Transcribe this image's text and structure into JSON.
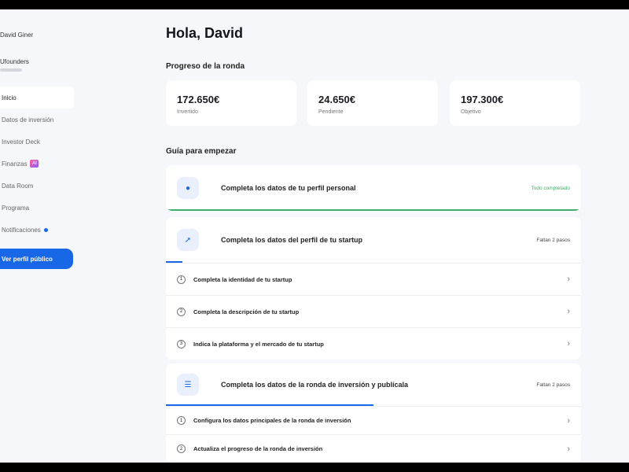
{
  "sidebar": {
    "user": "David Giner",
    "org": "Ufounders",
    "items": [
      {
        "label": "Inicio"
      },
      {
        "label": "Datos de inversión"
      },
      {
        "label": "Investor Deck"
      },
      {
        "label": "Finanzas",
        "badge": "AI"
      },
      {
        "label": "Data Room"
      },
      {
        "label": "Programa"
      },
      {
        "label": "Notificaciones"
      }
    ],
    "public_button": "Ver perfil público"
  },
  "header": {
    "title": "Hola, David"
  },
  "progress": {
    "title": "Progreso de la ronda",
    "stats": [
      {
        "value": "172.650€",
        "label": "Invertido"
      },
      {
        "value": "24.650€",
        "label": "Pendiente"
      },
      {
        "value": "197.300€",
        "label": "Objetivo"
      }
    ]
  },
  "guide": {
    "title": "Guía para empezar",
    "cards": [
      {
        "title": "Completa los datos de tu perfil personal",
        "status": "Todo completado",
        "icon": "user-circle-icon",
        "progress": 1.0
      },
      {
        "title": "Completa los datos del perfil de tu startup",
        "status": "Faltan 2 pasos",
        "icon": "rocket-icon",
        "progress": 0.04,
        "steps": [
          {
            "n": "1",
            "label": "Completa la identidad de tu startup"
          },
          {
            "n": "2",
            "label": "Completa la descripción de tu startup"
          },
          {
            "n": "3",
            "label": "Indica la plataforma y el mercado de tu startup"
          }
        ]
      },
      {
        "title": "Completa los datos de la ronda de inversión y publícala",
        "status": "Faltan 2 pasos",
        "icon": "list-icon",
        "progress": 0.5,
        "steps": [
          {
            "n": "1",
            "label": "Configura los datos principales de la ronda de inversión"
          },
          {
            "n": "2",
            "label": "Actualiza el progreso de la ronda de inversión"
          }
        ]
      }
    ]
  },
  "colors": {
    "accent": "#1767e6",
    "success": "#3fae6a"
  }
}
